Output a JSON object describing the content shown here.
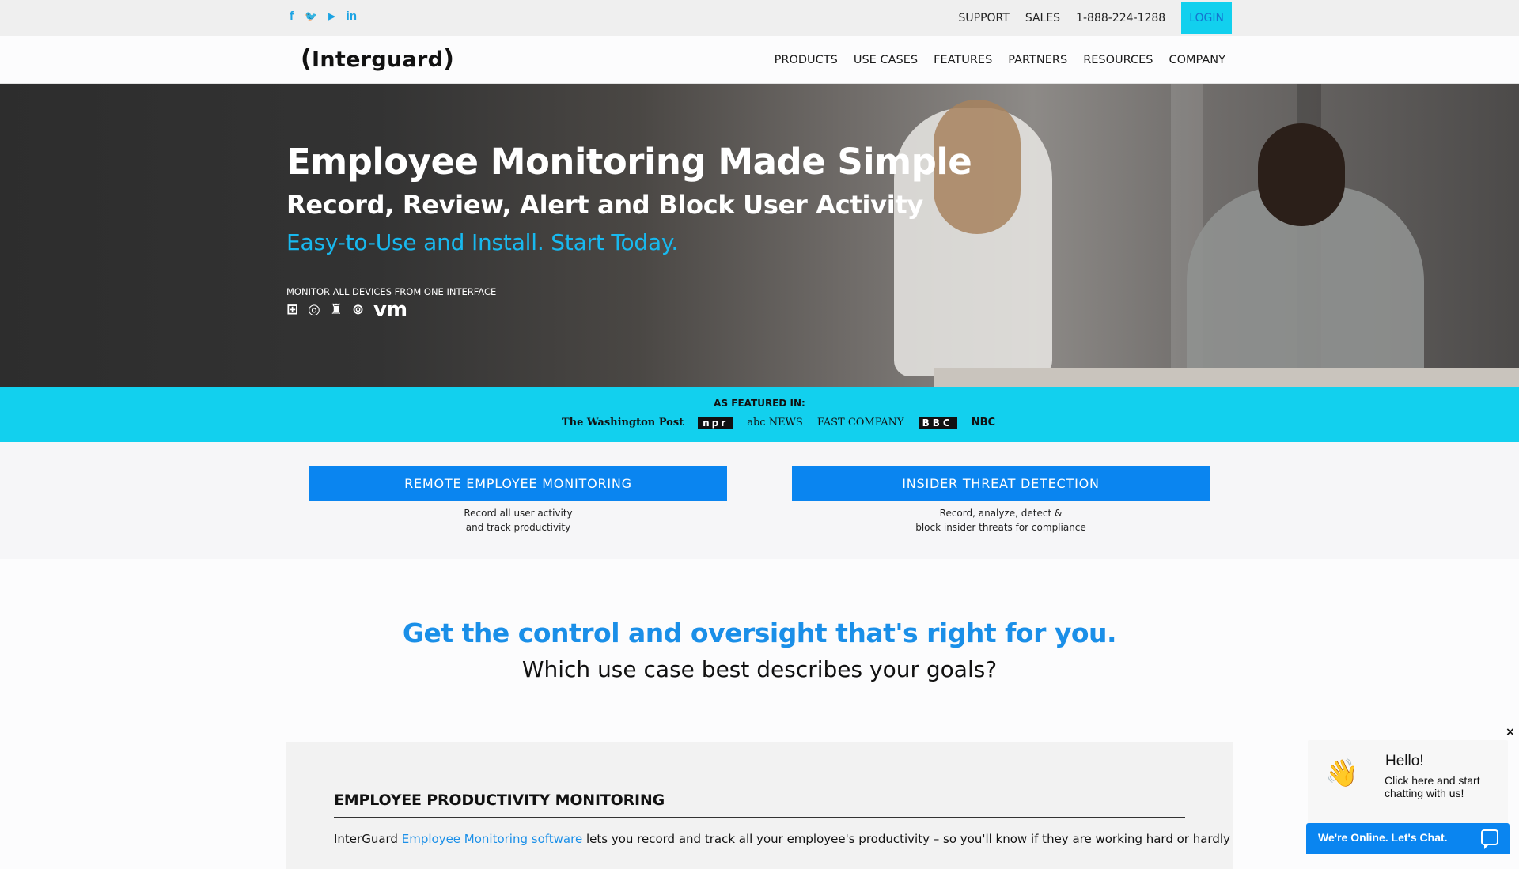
{
  "topbar": {
    "social": [
      {
        "icon": "facebook-icon",
        "glyph": "f"
      },
      {
        "icon": "twitter-icon",
        "glyph": "🐦"
      },
      {
        "icon": "youtube-icon",
        "glyph": "▶"
      },
      {
        "icon": "linkedin-icon",
        "glyph": "in"
      }
    ],
    "support": "SUPPORT",
    "sales": "SALES",
    "phone": "1-888-224-1288",
    "login": "LOGIN"
  },
  "header": {
    "logo": "Interguard",
    "nav": [
      "PRODUCTS",
      "USE CASES",
      "FEATURES",
      "PARTNERS",
      "RESOURCES",
      "COMPANY"
    ]
  },
  "hero": {
    "title": "Employee Monitoring Made Simple",
    "subtitle": "Record, Review, Alert and Block User Activity",
    "tagline": "Easy-to-Use and Install. Start Today.",
    "devices_label": "MONITOR ALL DEVICES FROM ONE INTERFACE",
    "device_icons": [
      "windows-icon",
      "chrome-icon",
      "android-icon",
      "mac-icon",
      "vmware-icon"
    ],
    "vm_text": "vm"
  },
  "featured": {
    "label": "AS FEATURED IN:",
    "outlets": [
      "The Washington Post",
      "npr",
      "abc NEWS",
      "FAST COMPANY",
      "BBC",
      "NBC"
    ]
  },
  "cases": [
    {
      "button": "REMOTE EMPLOYEE MONITORING",
      "desc1": "Record all user activity",
      "desc2": "and track productivity"
    },
    {
      "button": "INSIDER THREAT DETECTION",
      "desc1": "Record, analyze, detect &",
      "desc2": "block insider threats for compliance"
    }
  ],
  "control": {
    "title": "Get the control and oversight that's right for you.",
    "subtitle": "Which use case best describes your goals?"
  },
  "panel": {
    "title": "EMPLOYEE PRODUCTIVITY MONITORING",
    "text_before": "InterGuard ",
    "link": "Employee Monitoring software",
    "text_after": " lets you record and track all your employee's productivity – so you'll know if they are working hard or hardly"
  },
  "chat": {
    "close": "×",
    "hello": "Hello!",
    "sub": "Click here and start chatting with us!",
    "bar": "We're Online. Let's Chat."
  },
  "colors": {
    "accent_cyan": "#12d0ee",
    "accent_blue": "#0a85f0",
    "link_blue": "#1a8fe8"
  }
}
